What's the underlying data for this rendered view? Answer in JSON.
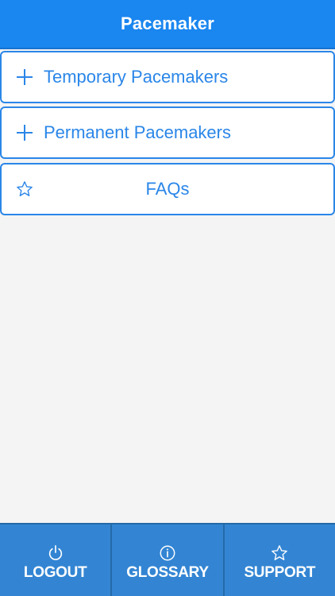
{
  "header": {
    "title": "Pacemaker"
  },
  "menu": {
    "items": [
      {
        "label": "Temporary Pacemakers",
        "icon": "plus-icon"
      },
      {
        "label": "Permanent Pacemakers",
        "icon": "plus-icon"
      },
      {
        "label": "FAQs",
        "icon": "star-icon"
      }
    ]
  },
  "footer": {
    "tabs": [
      {
        "label": "LOGOUT",
        "icon": "power-icon"
      },
      {
        "label": "GLOSSARY",
        "icon": "info-icon"
      },
      {
        "label": "SUPPORT",
        "icon": "star-icon"
      }
    ]
  },
  "colors": {
    "header_bg": "#1a86f0",
    "accent": "#2a86e8",
    "footer_bg": "#3385d3",
    "page_bg": "#f4f4f4"
  }
}
